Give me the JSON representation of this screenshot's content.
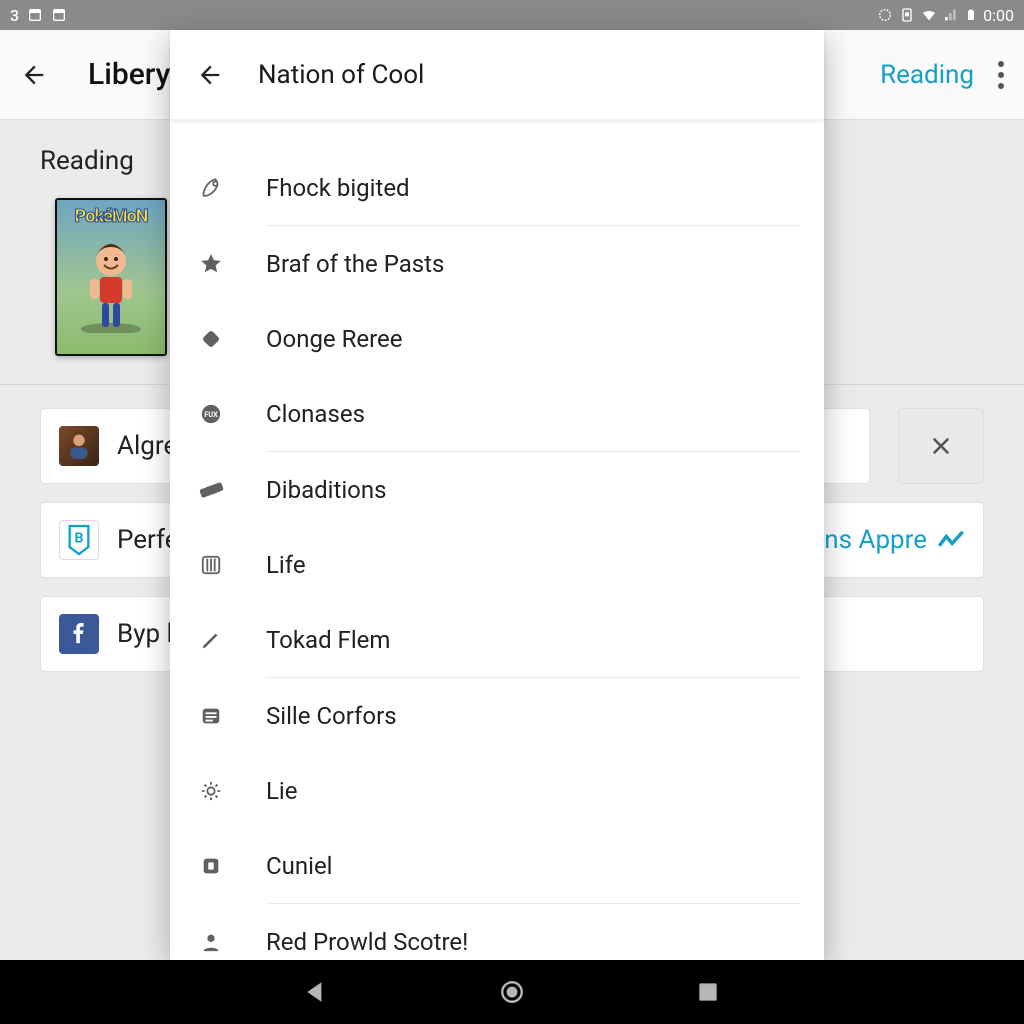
{
  "status_bar": {
    "left_text": "3",
    "time": "0:00"
  },
  "toolbar": {
    "title": "Libery",
    "reading_link": "Reading"
  },
  "underlying": {
    "section_title": "Reading",
    "book_logo": "PokéMoN",
    "cards": {
      "0": {
        "label": "Algre c"
      },
      "1": {
        "label": "Perfee",
        "right_text": "ns Appre"
      },
      "2": {
        "label": "Byp lo"
      }
    }
  },
  "overlay": {
    "title": "Nation of Cool",
    "items": {
      "0": {
        "label": "Fhock bigited",
        "icon": "rocket-icon"
      },
      "1": {
        "label": "Braf of the Pasts",
        "icon": "star-icon"
      },
      "2": {
        "label": "Oonge Reree",
        "icon": "diamond-icon"
      },
      "3": {
        "label": "Clonases",
        "icon": "badge-icon"
      },
      "4": {
        "label": "Dibaditions",
        "icon": "tickets-icon"
      },
      "5": {
        "label": "Life",
        "icon": "columns-icon"
      },
      "6": {
        "label": "Tokad Flem",
        "icon": "pencil-icon"
      },
      "7": {
        "label": "Sille Corfors",
        "icon": "list-icon"
      },
      "8": {
        "label": "Lie",
        "icon": "gear-icon"
      },
      "9": {
        "label": "Cuniel",
        "icon": "square-icon"
      },
      "10": {
        "label": "Red Prowld Scotre!",
        "icon": "person-icon"
      }
    }
  }
}
